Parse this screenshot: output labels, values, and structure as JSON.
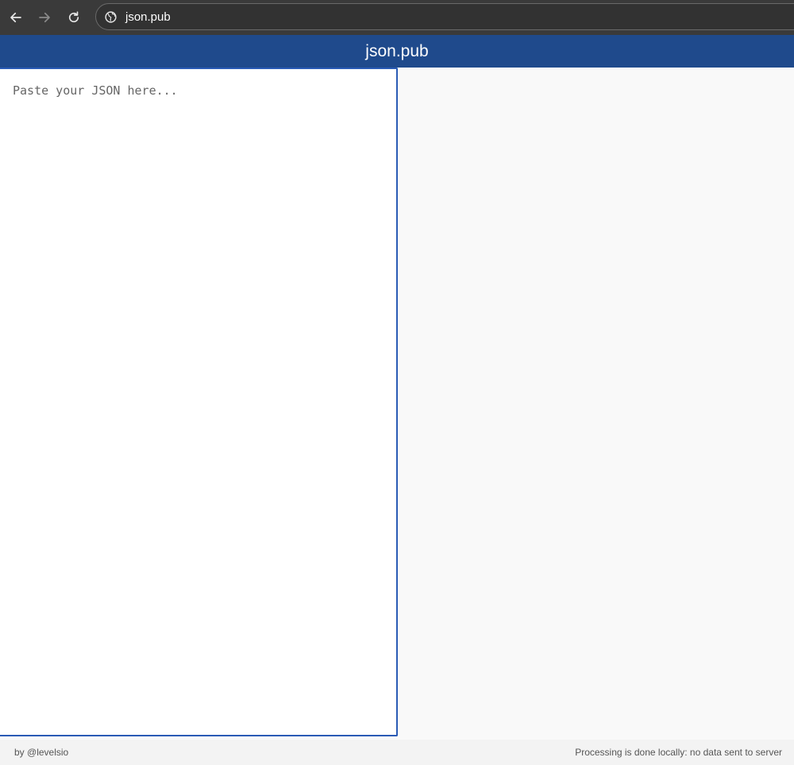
{
  "browser": {
    "url": "json.pub",
    "icons": [
      "back-arrow-icon",
      "forward-arrow-icon",
      "reload-icon",
      "globe-icon"
    ]
  },
  "header": {
    "title": "json.pub",
    "color": "#1f4a8c"
  },
  "editor": {
    "placeholder": "Paste your JSON here...",
    "value": ""
  },
  "footer": {
    "credit": "by @levelsio",
    "privacy_note": "Processing is done locally: no data sent to server"
  }
}
